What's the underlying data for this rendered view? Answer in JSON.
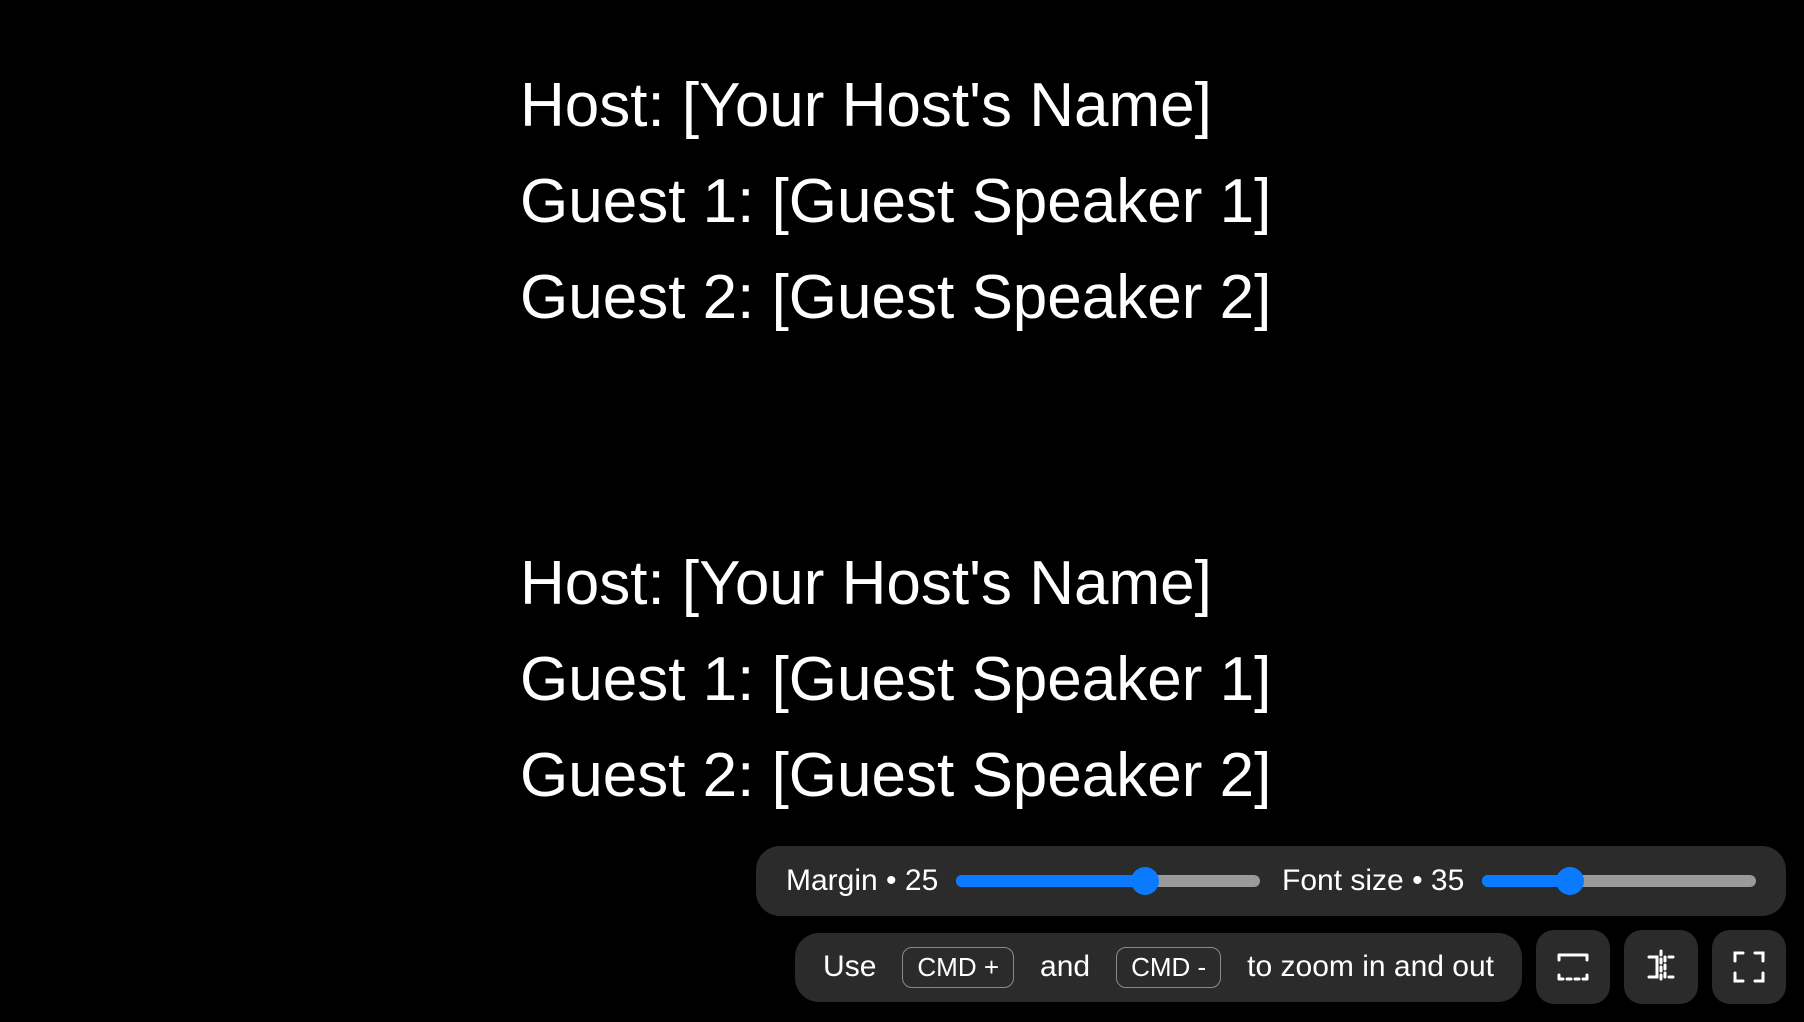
{
  "content": {
    "block1": "Host: [Your Host's Name] Guest 1: [Guest Speaker 1] Guest 2: [Guest Speaker 2]",
    "block2": "Host: [Your Host's Name] Guest 1: [Guest Speaker 1] Guest 2: [Guest Speaker 2]"
  },
  "controls": {
    "margin": {
      "label": "Margin",
      "sep": "•",
      "value": "25",
      "percent": 62
    },
    "font_size": {
      "label": "Font size",
      "sep": "•",
      "value": "35",
      "percent": 32
    },
    "hint": {
      "prefix": "Use",
      "kbd1": "CMD +",
      "mid": "and",
      "kbd2": "CMD -",
      "suffix": "to zoom in and out"
    }
  }
}
